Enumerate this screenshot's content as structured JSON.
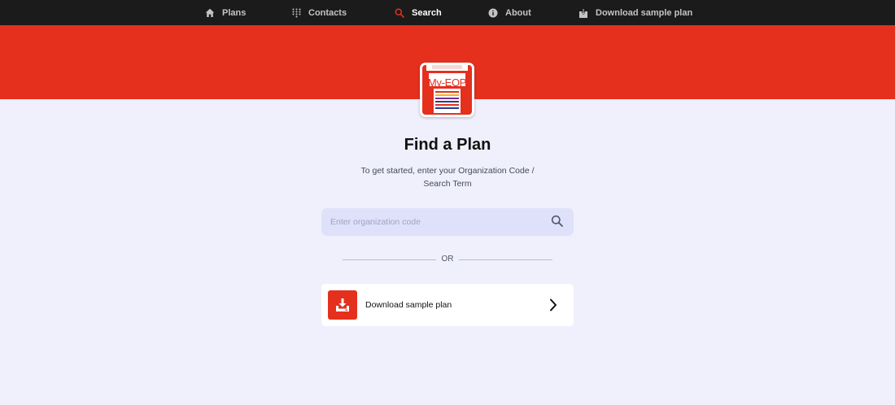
{
  "nav": {
    "items": [
      {
        "label": "Plans",
        "icon": "home-icon",
        "active": false
      },
      {
        "label": "Contacts",
        "icon": "keypad-icon",
        "active": false
      },
      {
        "label": "Search",
        "icon": "search-icon",
        "active": true
      },
      {
        "label": "About",
        "icon": "info-icon",
        "active": false
      },
      {
        "label": "Download sample plan",
        "icon": "download-box-icon",
        "active": false
      }
    ]
  },
  "logo": {
    "text": "My-EOP"
  },
  "page": {
    "title": "Find a Plan",
    "subtitle": "To get started, enter your Organization Code / Search Term"
  },
  "search": {
    "placeholder": "Enter organization code",
    "value": ""
  },
  "divider": {
    "label": "OR"
  },
  "download_card": {
    "label": "Download sample plan"
  },
  "colors": {
    "brand_red": "#e5301e",
    "nav_bg": "#1b1b1b",
    "page_bg": "#eff0fb",
    "search_bg": "#dfe1fa"
  }
}
